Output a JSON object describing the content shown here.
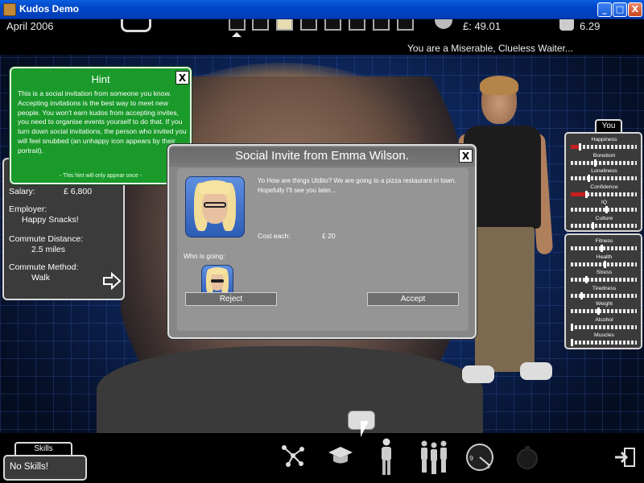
{
  "window": {
    "title": "Kudos Demo",
    "controls": [
      "_",
      "□",
      "X"
    ]
  },
  "top_hud": {
    "date": "April 2006",
    "money": "£: 49.01",
    "time": "6.29",
    "status": "You are a Miserable, Clueless Waiter...",
    "day_slots": 8,
    "active_slot": 3
  },
  "hint": {
    "title": "Hint",
    "close": "X",
    "body": "This is a social invitation from someone you know. Accepting invitations is the best way to meet new people. You won't earn kudos from accepting invites, you need to organise events yourself to do that. If you turn down social invitations, the person who invited you will feel snubbed (an unhappy icon appears by their portrait).",
    "footer": "- This hint will only appear once -"
  },
  "job": {
    "salary_label": "Salary:",
    "salary_value": "£ 6,800",
    "employer_label": "Employer:",
    "employer_value": "Happy Snacks!",
    "commute_distance_label": "Commute Distance:",
    "commute_distance_value": "2.5 miles",
    "commute_method_label": "Commute Method:",
    "commute_method_value": "Walk"
  },
  "invite": {
    "title": "Social Invite from Emma Wilson.",
    "close": "X",
    "message": "Yo How are things Utdito? We are going to a pizza restaurant in town. Hopefully I'll see you later...",
    "cost_label": "Cost each:",
    "cost_value": "£ 20",
    "who_going_label": "Who is going:",
    "reject_label": "Reject",
    "accept_label": "Accept"
  },
  "stats_panel": {
    "tab": "You",
    "mood": [
      {
        "name": "Happiness",
        "level": 0.12,
        "red": true
      },
      {
        "name": "Boredom",
        "level": 0.35,
        "red": false
      },
      {
        "name": "Loneliness",
        "level": 0.25,
        "red": false
      },
      {
        "name": "Confidence",
        "level": 0.22,
        "red": true
      },
      {
        "name": "IQ",
        "level": 0.52,
        "red": false
      },
      {
        "name": "Culture",
        "level": 0.32,
        "red": false
      }
    ],
    "body": [
      {
        "name": "Fitness",
        "level": 0.45
      },
      {
        "name": "Health",
        "level": 0.5
      },
      {
        "name": "Stress",
        "level": 0.22
      },
      {
        "name": "Tiredness",
        "level": 0.15
      },
      {
        "name": "Weight",
        "level": 0.4
      },
      {
        "name": "Alcohol",
        "level": 0.0
      },
      {
        "name": "Muscles",
        "level": 0.0
      }
    ]
  },
  "skills": {
    "tab": "Skills",
    "value": "No Skills!"
  },
  "bottom_icons": [
    "network-icon",
    "graduation-cap-icon",
    "person-icon",
    "group-icon",
    "clock-icon",
    "bomb-icon",
    "exit-icon"
  ],
  "clock_icon_numbers": [
    "9",
    "3"
  ],
  "colors": {
    "hint_green": "#1a9a2a",
    "panel_grey": "#3b3b3b",
    "dialog_grey": "#868686",
    "alert_red": "#c81e1e",
    "titlebar_blue": "#0047c8"
  }
}
